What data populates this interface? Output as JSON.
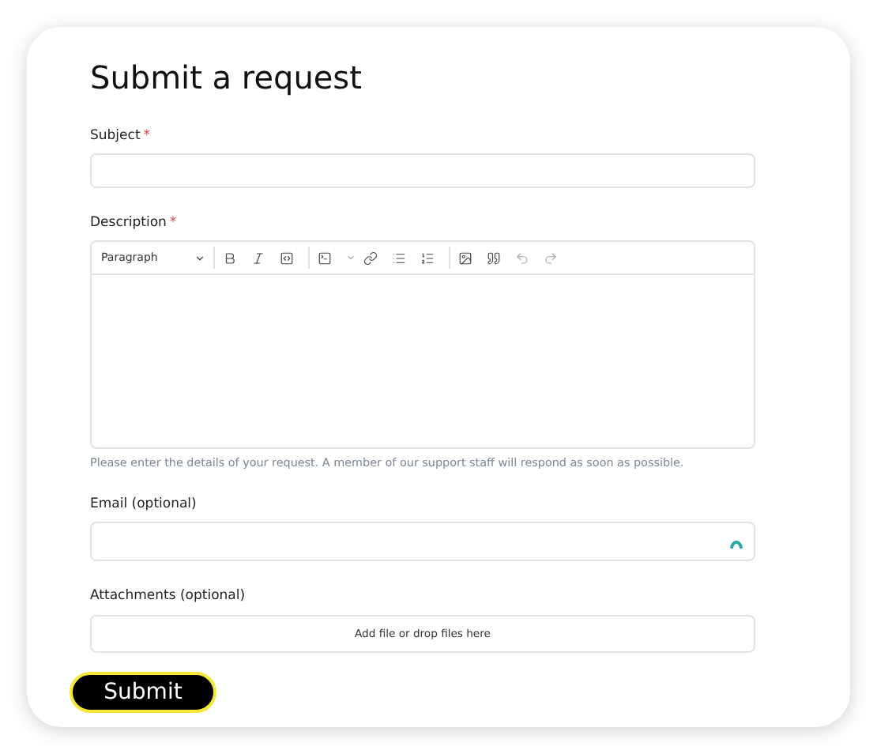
{
  "title": "Submit a request",
  "subject": {
    "label": "Subject",
    "required_mark": "*"
  },
  "description": {
    "label": "Description",
    "required_mark": "*",
    "format": "Paragraph",
    "toolbar": [
      {
        "kind": "bold"
      },
      {
        "kind": "italic"
      },
      {
        "kind": "code"
      },
      {
        "kind": "sep"
      },
      {
        "kind": "codeblock"
      },
      {
        "kind": "caret"
      },
      {
        "kind": "link"
      },
      {
        "kind": "bullets"
      },
      {
        "kind": "numbers"
      },
      {
        "kind": "sep"
      },
      {
        "kind": "image"
      },
      {
        "kind": "quote"
      },
      {
        "kind": "undo"
      },
      {
        "kind": "redo"
      }
    ],
    "hint": "Please enter the details of your request. A member of our support staff will respond as soon as possible."
  },
  "email": {
    "label": "Email (optional)"
  },
  "attachments": {
    "label": "Attachments (optional)",
    "prompt": "Add file or drop files here"
  },
  "submit": "Submit"
}
